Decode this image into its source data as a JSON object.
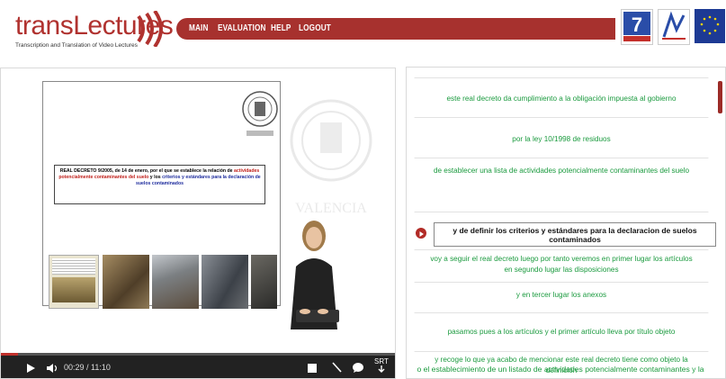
{
  "header": {
    "logo_text": "transLectures",
    "logo_subtitle": "Transcription and Translation of Video Lectures",
    "nav": [
      {
        "label": "MAIN"
      },
      {
        "label": "EVALUATION"
      },
      {
        "label": "HELP"
      },
      {
        "label": "LOGOUT"
      }
    ],
    "partner_fp7_label": "COOPERATION",
    "partner_upv_label": "UPV"
  },
  "video": {
    "slide_title_prefix": "REAL DECRETO 9/2005, de 14 de enero, por el que se establece la relación de",
    "slide_title_red": "actividades potencialmente contaminantes del suelo",
    "slide_title_mid": " y los ",
    "slide_title_blue": "criterios y estándares",
    "slide_title_suffix": "para la declaración de suelos contaminados",
    "time_display": "00:29 / 11:10",
    "srt_label": "SRT",
    "progress_fraction": 0.043
  },
  "transcript": {
    "segments": [
      {
        "text": "este real decreto da cumplimiento a la obligación impuesta al gobierno"
      },
      {
        "text": "por la ley 10/1998 de residuos"
      },
      {
        "text": "de establecer una lista de actividades potencialmente contaminantes del suelo"
      },
      {
        "text": "voy a seguir el real decreto luego por tanto veremos en primer lugar los artículos"
      },
      {
        "text": "en segundo lugar las disposiciones"
      },
      {
        "text": "y en tercer lugar los anexos"
      },
      {
        "text": "pasamos pues a los artículos y el primer artículo lleva por título objeto"
      },
      {
        "text": "y recoge lo que ya acabo de mencionar este real decreto tiene como objeto la"
      },
      {
        "text": "definición"
      },
      {
        "text": "o el establecimiento de un listado de actividades potencialmente contaminantes y la"
      }
    ],
    "editing_text_line1": "y de definir los criterios y estándares para la declaracion de suelos",
    "editing_text_line2": "contaminados"
  },
  "colors": {
    "brand_red": "#a7312e",
    "transcript_green": "#1a9a3e"
  }
}
